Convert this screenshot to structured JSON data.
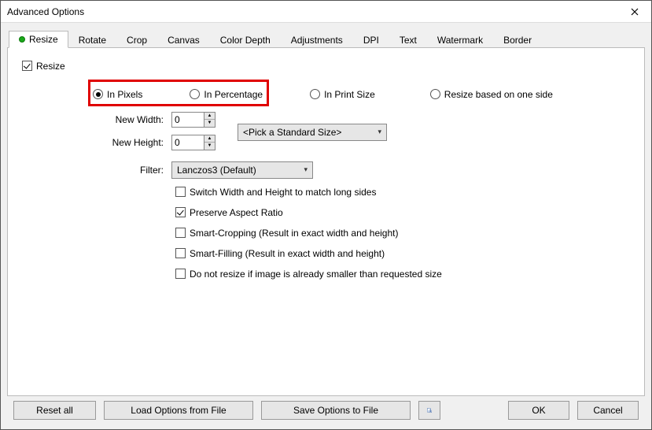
{
  "window": {
    "title": "Advanced Options"
  },
  "tabs": {
    "resize": "Resize",
    "rotate": "Rotate",
    "crop": "Crop",
    "canvas": "Canvas",
    "color_depth": "Color Depth",
    "adjustments": "Adjustments",
    "dpi": "DPI",
    "text": "Text",
    "watermark": "Watermark",
    "border": "Border"
  },
  "resize_checkbox": "Resize",
  "radios": {
    "in_pixels": "In Pixels",
    "in_percentage": "In Percentage",
    "in_print_size": "In Print Size",
    "one_side": "Resize based on one side"
  },
  "labels": {
    "new_width": "New Width:",
    "new_height": "New Height:",
    "filter": "Filter:"
  },
  "values": {
    "new_width": "0",
    "new_height": "0",
    "standard_size": "<Pick a Standard Size>",
    "filter": "Lanczos3 (Default)"
  },
  "options": {
    "switch_wh": "Switch Width and Height to match long sides",
    "preserve_ar": "Preserve Aspect Ratio",
    "smart_crop": "Smart-Cropping (Result in exact width and height)",
    "smart_fill": "Smart-Filling (Result in exact width and height)",
    "no_enlarge": "Do not resize if image is already smaller than requested size"
  },
  "buttons": {
    "reset": "Reset all",
    "load": "Load Options from File",
    "save": "Save Options to File",
    "ok": "OK",
    "cancel": "Cancel"
  }
}
